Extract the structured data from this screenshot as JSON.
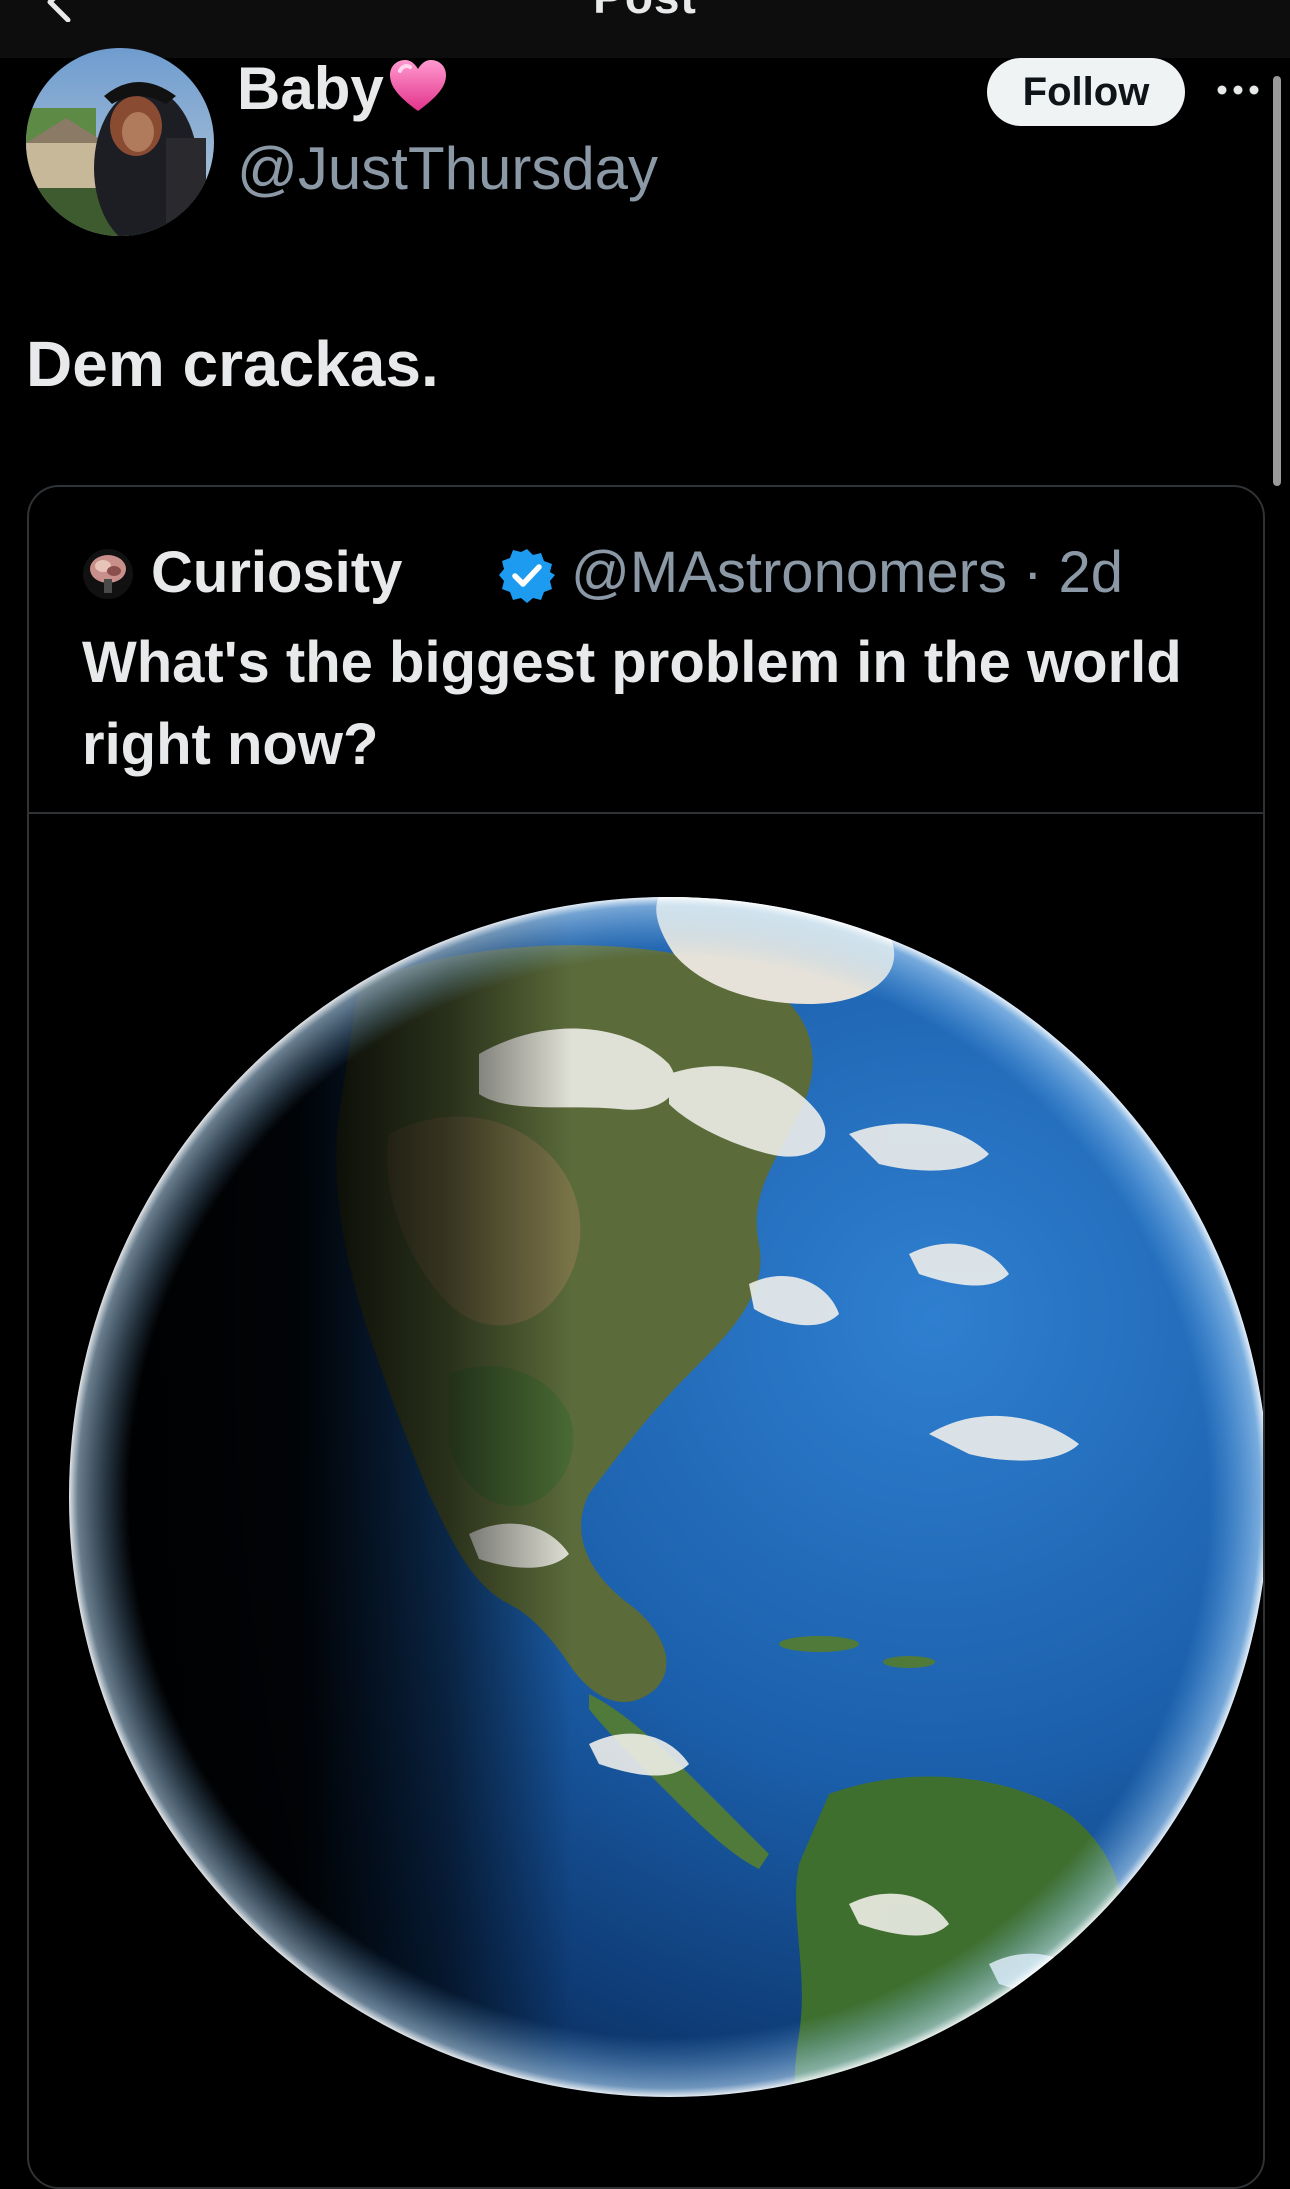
{
  "header": {
    "title": "Post",
    "back_icon": "chevron-left-icon"
  },
  "post": {
    "author_name": "Baby",
    "author_emoji": "pink-heart-icon",
    "author_handle": "@JustThursday",
    "follow_label": "Follow",
    "more_icon": "more-horizontal-icon",
    "text": "Dem crackas."
  },
  "quote": {
    "author_name": "Curiosity",
    "verified_icon": "verified-badge-icon",
    "handle_time": "@MAstronomers · 2d",
    "text": "What's the biggest problem in the world right now?",
    "media": "earth-from-space-image"
  },
  "colors": {
    "background": "#000000",
    "primary_text": "#e7e9ea",
    "secondary_text": "#8b98a5",
    "border": "#2f3336",
    "verified": "#1d9bf0",
    "follow_bg": "#eff3f4"
  }
}
